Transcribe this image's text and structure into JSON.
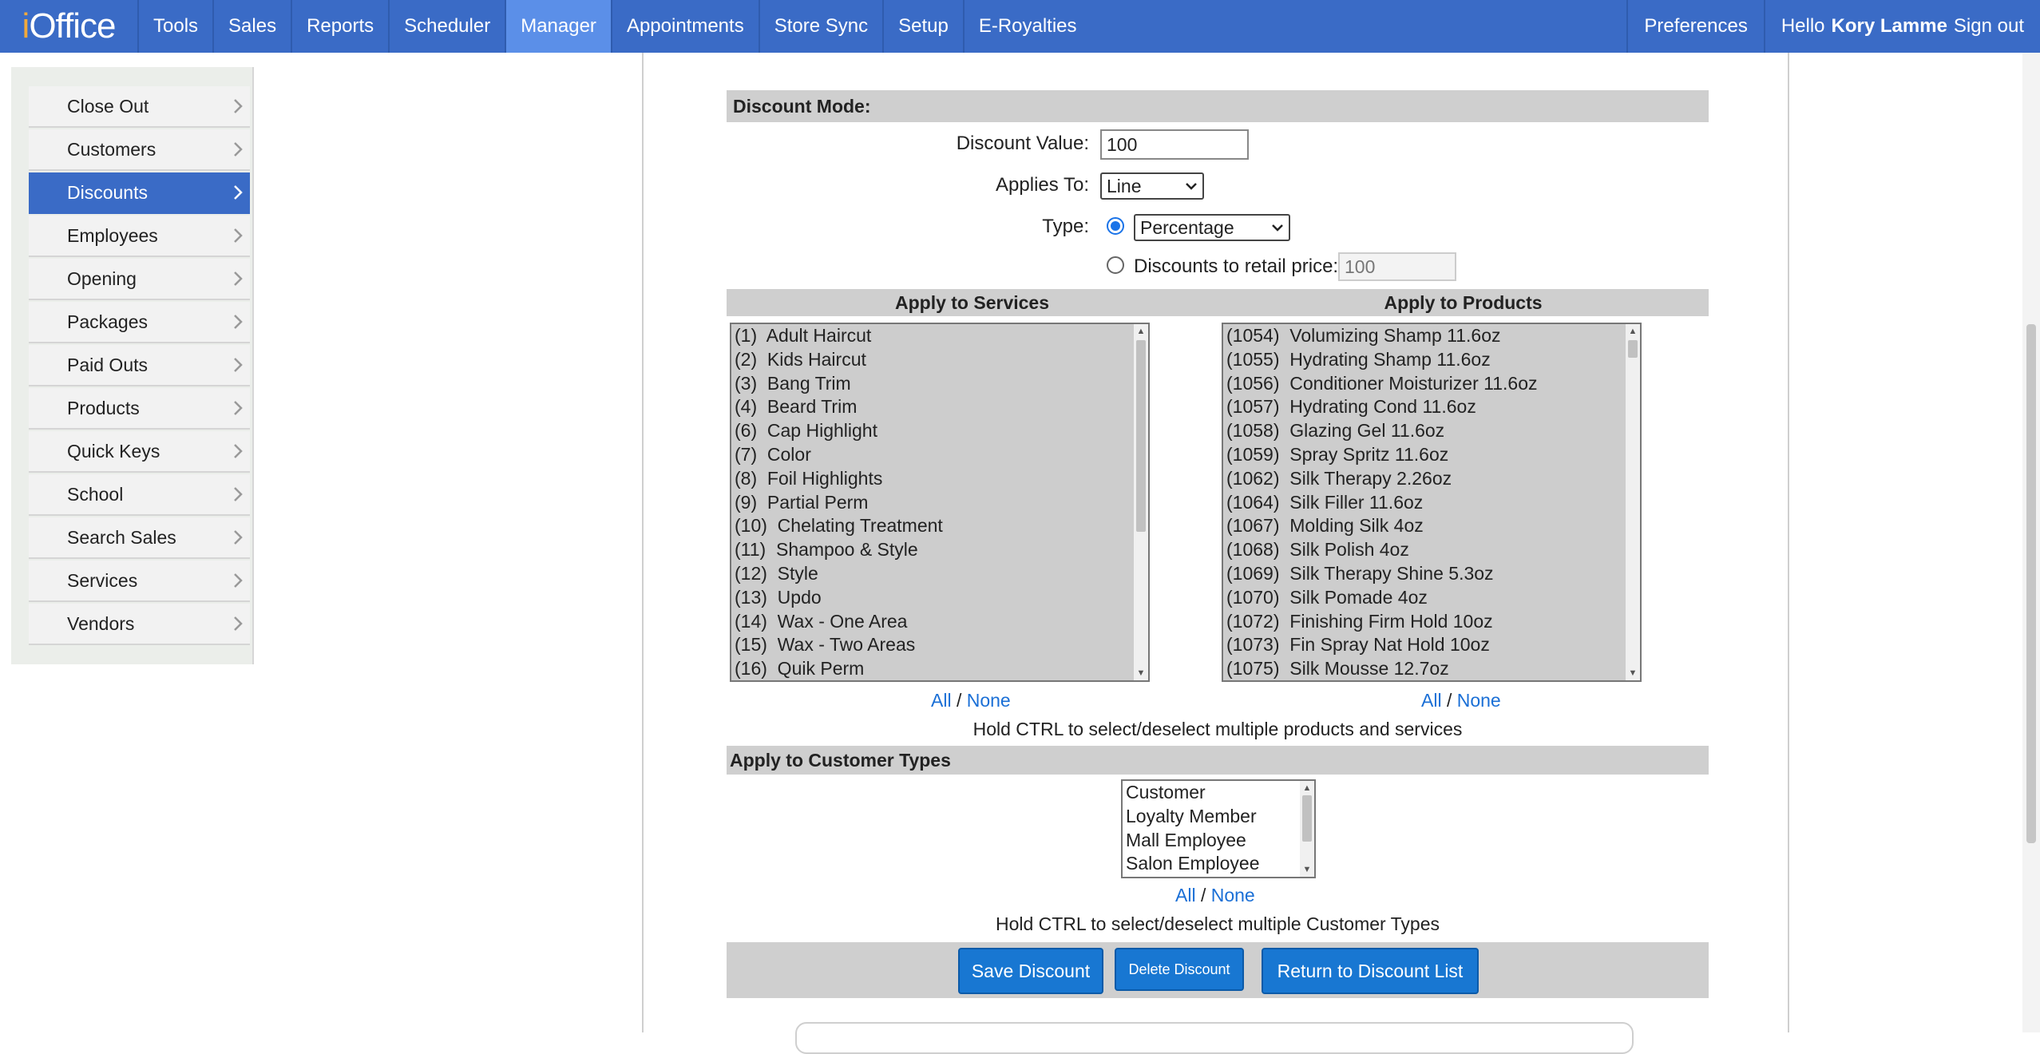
{
  "brand": {
    "prefix": "i",
    "name": "Office"
  },
  "nav": {
    "items": [
      {
        "label": "Tools",
        "active": false
      },
      {
        "label": "Sales",
        "active": false
      },
      {
        "label": "Reports",
        "active": false
      },
      {
        "label": "Scheduler",
        "active": false
      },
      {
        "label": "Manager",
        "active": true
      },
      {
        "label": "Appointments",
        "active": false
      },
      {
        "label": "Store Sync",
        "active": false
      },
      {
        "label": "Setup",
        "active": false
      },
      {
        "label": "E-Royalties",
        "active": false
      }
    ],
    "preferences": "Preferences",
    "hello": "Hello",
    "user_name": "Kory Lamme",
    "sign_out": "Sign out"
  },
  "sidebar": {
    "items": [
      {
        "label": "Close Out",
        "active": false
      },
      {
        "label": "Customers",
        "active": false
      },
      {
        "label": "Discounts",
        "active": true
      },
      {
        "label": "Employees",
        "active": false
      },
      {
        "label": "Opening",
        "active": false
      },
      {
        "label": "Packages",
        "active": false
      },
      {
        "label": "Paid Outs",
        "active": false
      },
      {
        "label": "Products",
        "active": false
      },
      {
        "label": "Quick Keys",
        "active": false
      },
      {
        "label": "School",
        "active": false
      },
      {
        "label": "Search Sales",
        "active": false
      },
      {
        "label": "Services",
        "active": false
      },
      {
        "label": "Vendors",
        "active": false
      }
    ]
  },
  "form": {
    "mode_header": "Discount Mode:",
    "discount_value_label": "Discount Value:",
    "discount_value": "100",
    "applies_to_label": "Applies To:",
    "applies_to_value": "Line",
    "type_label": "Type:",
    "type_value": "Percentage",
    "retail_label": "Discounts to retail price:",
    "retail_value": "100",
    "services_header": "Apply to Services",
    "products_header": "Apply to Products",
    "services": [
      "(1)  Adult Haircut",
      "(2)  Kids Haircut",
      "(3)  Bang Trim",
      "(4)  Beard Trim",
      "(6)  Cap Highlight",
      "(7)  Color",
      "(8)  Foil Highlights",
      "(9)  Partial Perm",
      "(10)  Chelating Treatment",
      "(11)  Shampoo & Style",
      "(12)  Style",
      "(13)  Updo",
      "(14)  Wax - One Area",
      "(15)  Wax - Two Areas",
      "(16)  Quik Perm"
    ],
    "products": [
      "(1054)  Volumizing Shamp 11.6oz",
      "(1055)  Hydrating Shamp 11.6oz",
      "(1056)  Conditioner Moisturizer 11.6oz",
      "(1057)  Hydrating Cond 11.6oz",
      "(1058)  Glazing Gel 11.6oz",
      "(1059)  Spray Spritz 11.6oz",
      "(1062)  Silk Therapy 2.26oz",
      "(1064)  Silk Filler 11.6oz",
      "(1067)  Molding Silk 4oz",
      "(1068)  Silk Polish 4oz",
      "(1069)  Silk Therapy Shine 5.3oz",
      "(1070)  Silk Pomade 4oz",
      "(1072)  Finishing Firm Hold 10oz",
      "(1073)  Fin Spray Nat Hold 10oz",
      "(1075)  Silk Mousse 12.7oz"
    ],
    "all_label": "All",
    "none_label": "None",
    "slash": "/",
    "multi_note": "Hold CTRL to select/deselect multiple products and services",
    "customer_types_header": "Apply to Customer Types",
    "customer_types": [
      "Customer",
      "Loyalty Member",
      "Mall Employee",
      "Salon Employee"
    ],
    "customer_note": "Hold CTRL to select/deselect multiple Customer Types",
    "save_label": "Save Discount",
    "delete_label": "Delete Discount",
    "return_label": "Return to Discount List"
  },
  "icons": {
    "chevron": "chevron-right-icon",
    "dropdown": "chevron-down-icon"
  }
}
